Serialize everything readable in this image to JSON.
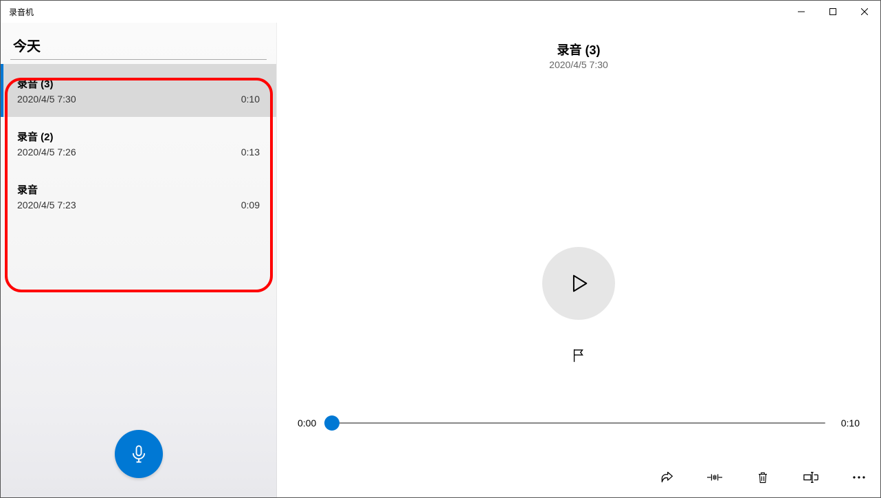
{
  "titlebar": {
    "title": "录音机"
  },
  "sidebar": {
    "section_label": "今天",
    "recordings": [
      {
        "title": "录音 (3)",
        "datetime": "2020/4/5 7:30",
        "duration": "0:10",
        "selected": true
      },
      {
        "title": "录音 (2)",
        "datetime": "2020/4/5 7:26",
        "duration": "0:13",
        "selected": false
      },
      {
        "title": "录音",
        "datetime": "2020/4/5 7:23",
        "duration": "0:09",
        "selected": false
      }
    ]
  },
  "content": {
    "title": "录音 (3)",
    "datetime": "2020/4/5 7:30",
    "time_current": "0:00",
    "time_total": "0:10"
  },
  "colors": {
    "accent": "#0078d4",
    "highlight_border": "#ff0000"
  }
}
